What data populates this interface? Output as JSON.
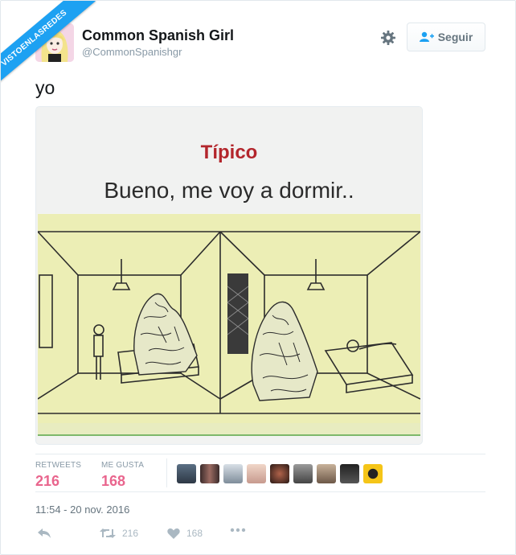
{
  "watermark": "VISTOENLASREDES",
  "tweet": {
    "author_name": "Common Spanish Girl",
    "author_handle": "@CommonSpanishgr",
    "follow_label": "Seguir",
    "text": "yo",
    "media": {
      "title": "Típico",
      "subtitle": "Bueno, me voy a dormir.."
    },
    "stats": {
      "retweets_label": "RETWEETS",
      "retweets_count": "216",
      "likes_label": "ME GUSTA",
      "likes_count": "168"
    },
    "timestamp": "11:54 - 20 nov. 2016",
    "actions": {
      "retweet_count": "216",
      "like_count": "168"
    }
  },
  "colors": {
    "accent": "#1da1f2",
    "like": "#e0245e",
    "title_red": "#b3262c"
  },
  "icons": [
    "gear-icon",
    "add-user-icon",
    "reply-icon",
    "retweet-icon",
    "heart-icon",
    "more-icon"
  ]
}
